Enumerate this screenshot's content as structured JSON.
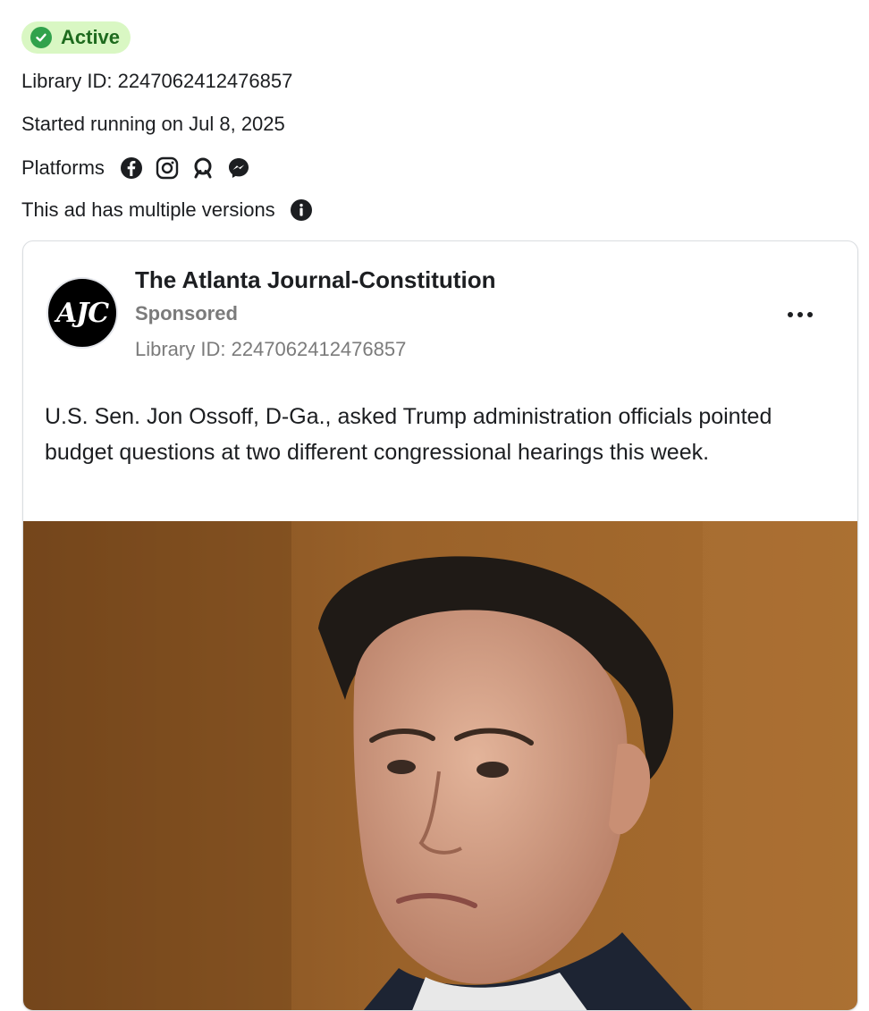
{
  "status": {
    "label": "Active"
  },
  "meta": {
    "library_id": "Library ID: 2247062412476857",
    "started": "Started running on Jul 8, 2025",
    "platforms_label": "Platforms",
    "platforms": [
      "facebook-icon",
      "instagram-icon",
      "audience-network-icon",
      "messenger-icon"
    ],
    "versions_note": "This ad has multiple versions"
  },
  "ad": {
    "advertiser": "The Atlanta Journal-Constitution",
    "logo_text": "AJC",
    "sponsored": "Sponsored",
    "library_id": "Library ID: 2247062412476857",
    "body": "U.S. Sen. Jon Ossoff, D-Ga., asked Trump administration officials pointed budget questions at two different congressional hearings this week."
  },
  "colors": {
    "status_bg": "#d9f7c3",
    "status_text": "#1e6b1e",
    "status_check": "#31a24c",
    "secondary_text": "#7b7b7b"
  }
}
